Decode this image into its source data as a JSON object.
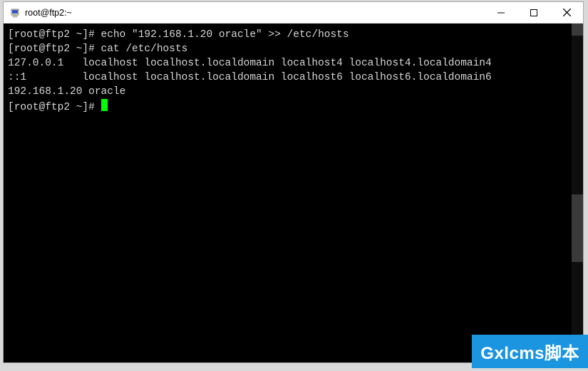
{
  "window": {
    "title": "root@ftp2:~"
  },
  "terminal": {
    "lines": [
      "[root@ftp2 ~]# echo \"192.168.1.20 oracle\" >> /etc/hosts",
      "[root@ftp2 ~]# cat /etc/hosts",
      "127.0.0.1   localhost localhost.localdomain localhost4 localhost4.localdomain4",
      "::1         localhost localhost.localdomain localhost6 localhost6.localdomain6",
      "192.168.1.20 oracle",
      "[root@ftp2 ~]# "
    ]
  },
  "watermark": "Gxlcms脚本"
}
